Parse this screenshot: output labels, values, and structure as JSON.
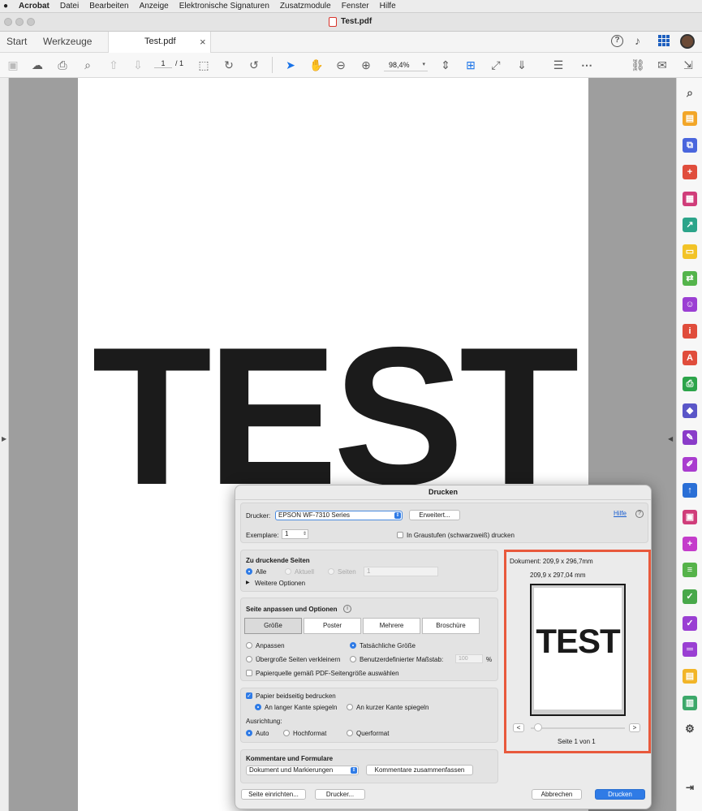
{
  "menubar": {
    "app": "Acrobat",
    "items": [
      "Datei",
      "Bearbeiten",
      "Anzeige",
      "Elektronische Signaturen",
      "Zusatzmodule",
      "Fenster",
      "Hilfe"
    ]
  },
  "window": {
    "title": "Test.pdf"
  },
  "tabs": {
    "start": "Start",
    "tools": "Werkzeuge",
    "doc": "Test.pdf",
    "close": "×"
  },
  "toolbar": {
    "page_current": "1",
    "page_total": "/ 1",
    "zoom": "98,4%"
  },
  "document": {
    "text": "TEST"
  },
  "dialog": {
    "title": "Drucken",
    "printer_label": "Drucker:",
    "printer_value": "EPSON WF-7310 Series",
    "advanced_button": "Erweitert...",
    "help_link": "Hilfe",
    "copies_label": "Exemplare:",
    "copies_value": "1",
    "grayscale_label": "In Graustufen (schwarzweiß) drucken",
    "pages_section": {
      "title": "Zu druckende Seiten",
      "all": "Alle",
      "current": "Aktuell",
      "pages": "Seiten",
      "pages_value": "1",
      "more": "Weitere Optionen"
    },
    "scale_section": {
      "title": "Seite anpassen und Optionen",
      "tabs": [
        "Größe",
        "Poster",
        "Mehrere",
        "Broschüre"
      ],
      "fit": "Anpassen",
      "actual": "Tatsächliche Größe",
      "shrink": "Übergroße Seiten verkleinern",
      "custom": "Benutzerdefinierter Maßstab:",
      "custom_value": "100",
      "percent": "%",
      "paper_source": "Papierquelle gemäß PDF-Seitengröße auswählen"
    },
    "duplex_section": {
      "duplex": "Papier beidseitig bedrucken",
      "long_edge": "An langer Kante spiegeln",
      "short_edge": "An kurzer Kante spiegeln",
      "orientation_label": "Ausrichtung:",
      "auto": "Auto",
      "portrait": "Hochformat",
      "landscape": "Querformat"
    },
    "comments_section": {
      "title": "Kommentare und Formulare",
      "select_value": "Dokument und Markierungen",
      "summarize_button": "Kommentare zusammenfassen"
    },
    "preview": {
      "document_size": "Dokument: 209,9 x 296,7mm",
      "paper_size": "209,9 x 297,04 mm",
      "preview_text": "TEST",
      "prev": "<",
      "next": ">",
      "page_info": "Seite 1 von 1"
    },
    "footer": {
      "page_setup": "Seite einrichten...",
      "printer": "Drucker...",
      "cancel": "Abbrechen",
      "print": "Drucken"
    }
  },
  "colors": {
    "accent": "#2f7be6",
    "highlight": "#e8593c",
    "acrobat_red": "#d9342b"
  }
}
